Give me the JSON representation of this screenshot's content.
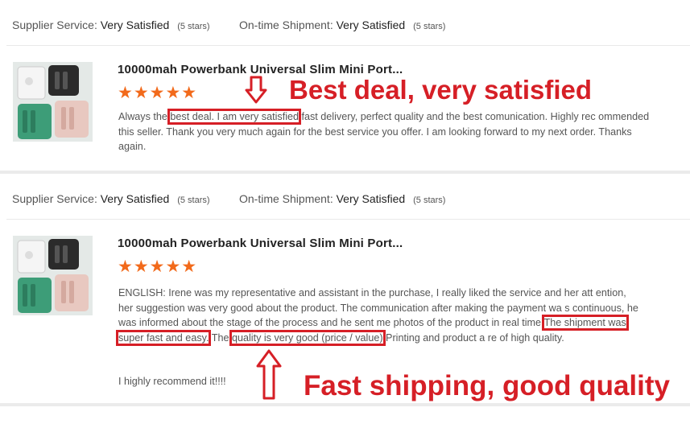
{
  "reviews": [
    {
      "supplier_label": "Supplier Service:",
      "supplier_value": "Very Satisfied",
      "supplier_stars": "(5 stars)",
      "shipment_label": "On-time Shipment:",
      "shipment_value": "Very Satisfied",
      "shipment_stars": "(5 stars)",
      "product_title": "10000mah Powerbank Universal Slim Mini Port...",
      "rating": 5,
      "stars": "★★★★★",
      "text_parts": [
        "Always the ",
        "best deal. I am very satisfied",
        " fast delivery, perfect quality and the best comunication. Highly rec ommended this seller. Thank you very much again for the best service you offer. I am looking forward to my next order. Thanks again."
      ]
    },
    {
      "supplier_label": "Supplier Service:",
      "supplier_value": "Very Satisfied",
      "supplier_stars": "(5 stars)",
      "shipment_label": "On-time Shipment:",
      "shipment_value": "Very Satisfied",
      "shipment_stars": "(5 stars)",
      "product_title": "10000mah Powerbank Universal Slim Mini Port...",
      "rating": 5,
      "stars": "★★★★★",
      "text_parts": [
        "ENGLISH:    Irene was my representative and assistant in the purchase, I really liked the service and her att ention, her suggestion was very good about the product. The communication after making the payment wa s continuous, he was informed about the stage of the process and he sent me photos of the product in real time.",
        "The shipment was super fast and easy.",
        " The ",
        "quality is very good (price / value)",
        " Printing and product a re of high quality."
      ],
      "text_extra": "I highly recommend it!!!!"
    }
  ],
  "annotations": {
    "top": "Best deal, very satisfied",
    "bottom": "Fast shipping, good quality"
  },
  "colors": {
    "accent": "#d61f26",
    "stars": "#f26a1b"
  }
}
